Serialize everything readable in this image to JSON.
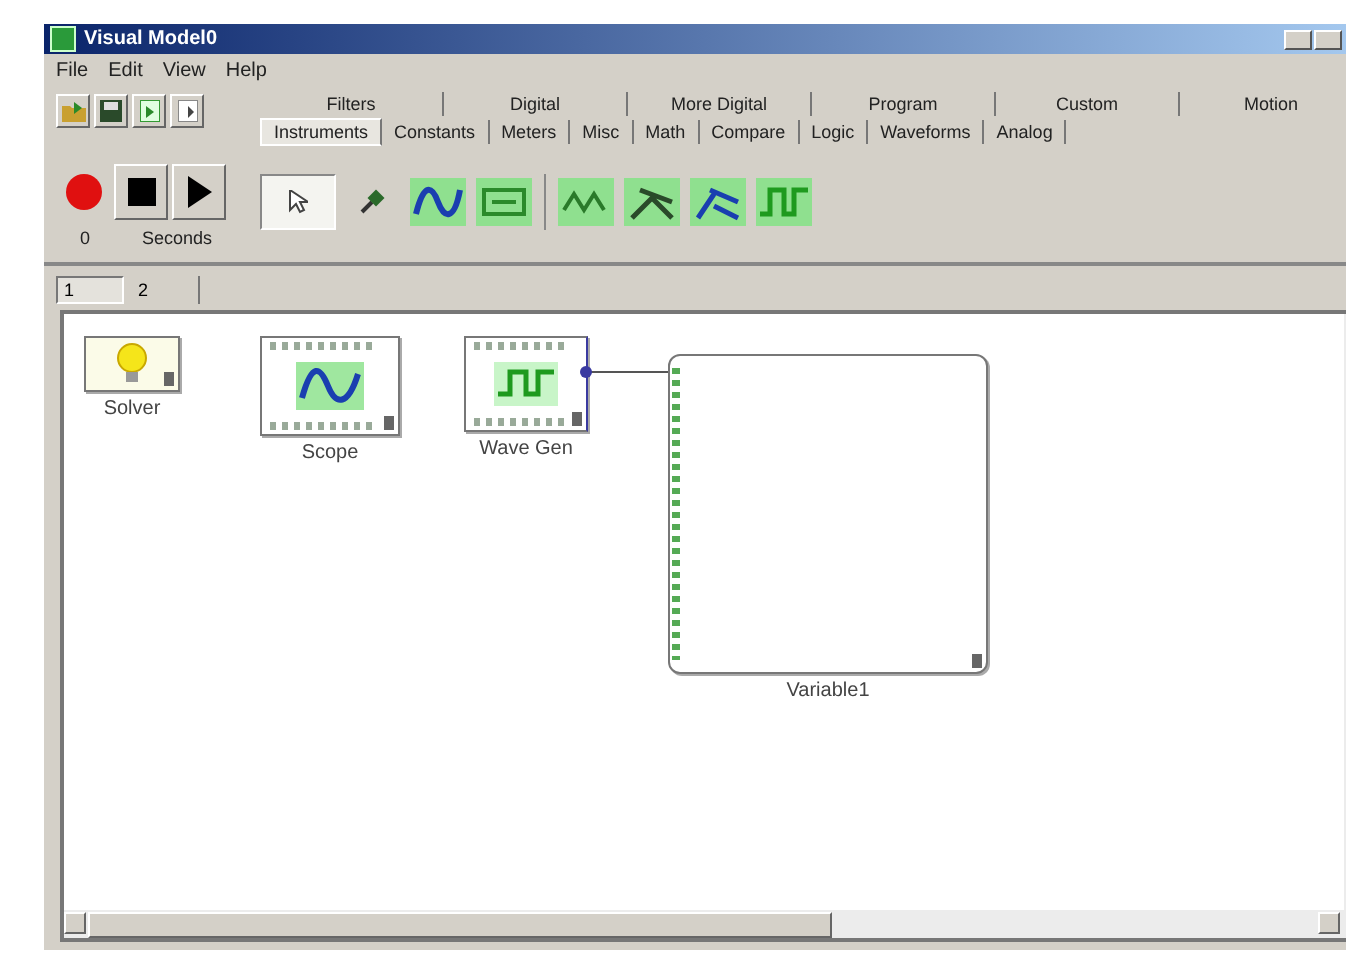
{
  "window": {
    "title": "Visual Model0"
  },
  "menu": [
    "File",
    "Edit",
    "View",
    "Help"
  ],
  "run_controls": {
    "time": "0",
    "unit": "Seconds"
  },
  "palette_rows": [
    {
      "tabs": [
        {
          "label": "Filters",
          "selected": false
        },
        {
          "label": "Digital",
          "selected": false
        },
        {
          "label": "More Digital",
          "selected": false
        },
        {
          "label": "Program",
          "selected": false
        },
        {
          "label": "Custom",
          "selected": false
        },
        {
          "label": "Motion",
          "selected": false
        }
      ]
    },
    {
      "tabs": [
        {
          "label": "Instruments",
          "selected": true
        },
        {
          "label": "Constants",
          "selected": false
        },
        {
          "label": "Meters",
          "selected": false
        },
        {
          "label": "Misc",
          "selected": false
        },
        {
          "label": "Math",
          "selected": false
        },
        {
          "label": "Compare",
          "selected": false
        },
        {
          "label": "Logic",
          "selected": false
        },
        {
          "label": "Waveforms",
          "selected": false
        },
        {
          "label": "Analog",
          "selected": false
        }
      ]
    }
  ],
  "page_tabs": [
    {
      "label": "1",
      "selected": true
    },
    {
      "label": "2",
      "selected": false
    }
  ],
  "blocks": [
    {
      "kind": "solver",
      "label": "Solver",
      "wired_to_next": false
    },
    {
      "kind": "scope",
      "label": "Scope",
      "wired_to_next": false
    },
    {
      "kind": "wavegen",
      "label": "Wave Gen",
      "wired_to_next": true
    },
    {
      "kind": "variable",
      "label": "Variable1",
      "wired_to_next": false
    }
  ]
}
